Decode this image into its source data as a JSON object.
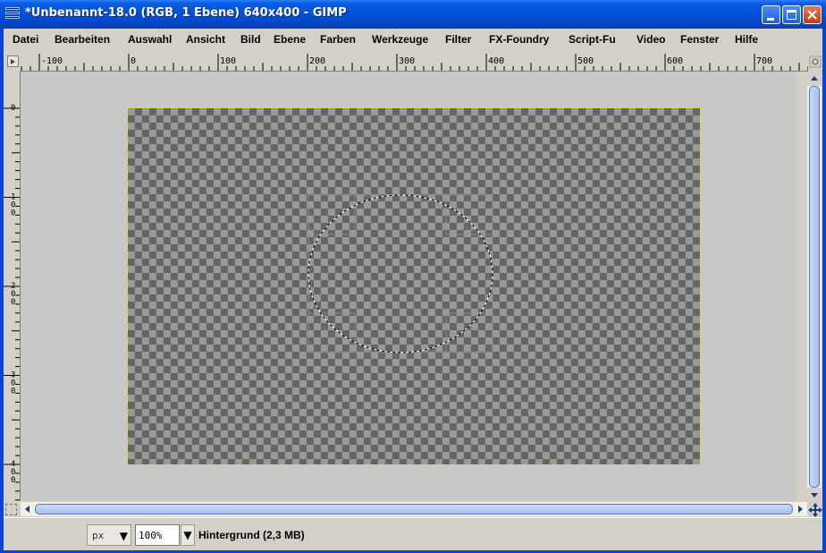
{
  "window": {
    "title": "*Unbenannt-18.0 (RGB, 1 Ebene) 640x400 - GIMP",
    "system_icon": "gimp-menu-icon",
    "controls": {
      "minimize_icon": "minimize-icon",
      "maximize_icon": "maximize-icon",
      "close_icon": "close-icon"
    }
  },
  "menubar": {
    "items": [
      {
        "label": "Datei"
      },
      {
        "label": "Bearbeiten"
      },
      {
        "label": "Auswahl"
      },
      {
        "label": "Ansicht"
      },
      {
        "label": "Bild"
      },
      {
        "label": "Ebene"
      },
      {
        "label": "Farben"
      },
      {
        "label": "Werkzeuge"
      },
      {
        "label": "Filter"
      },
      {
        "label": "FX-Foundry"
      },
      {
        "label": "Script-Fu"
      },
      {
        "label": "Video"
      },
      {
        "label": "Fenster"
      },
      {
        "label": "Hilfe"
      }
    ]
  },
  "rulers": {
    "horizontal_labels": [
      "-100",
      "0",
      "100",
      "200",
      "300",
      "400",
      "500",
      "600",
      "700"
    ],
    "vertical_labels": [
      "0",
      "100",
      "200",
      "300",
      "400"
    ]
  },
  "canvas": {
    "image_width": 640,
    "image_height": 400,
    "background": "transparent-checkerboard",
    "selection": "ellipse"
  },
  "statusbar": {
    "unit": "px",
    "zoom": "100",
    "zoom_suffix": "%",
    "layer_info": "Hintergrund (2,3 MB)"
  },
  "colors": {
    "titlebar": "#0552d8",
    "chrome": "#d4d0c8",
    "selection_dash": "#e8e000"
  }
}
